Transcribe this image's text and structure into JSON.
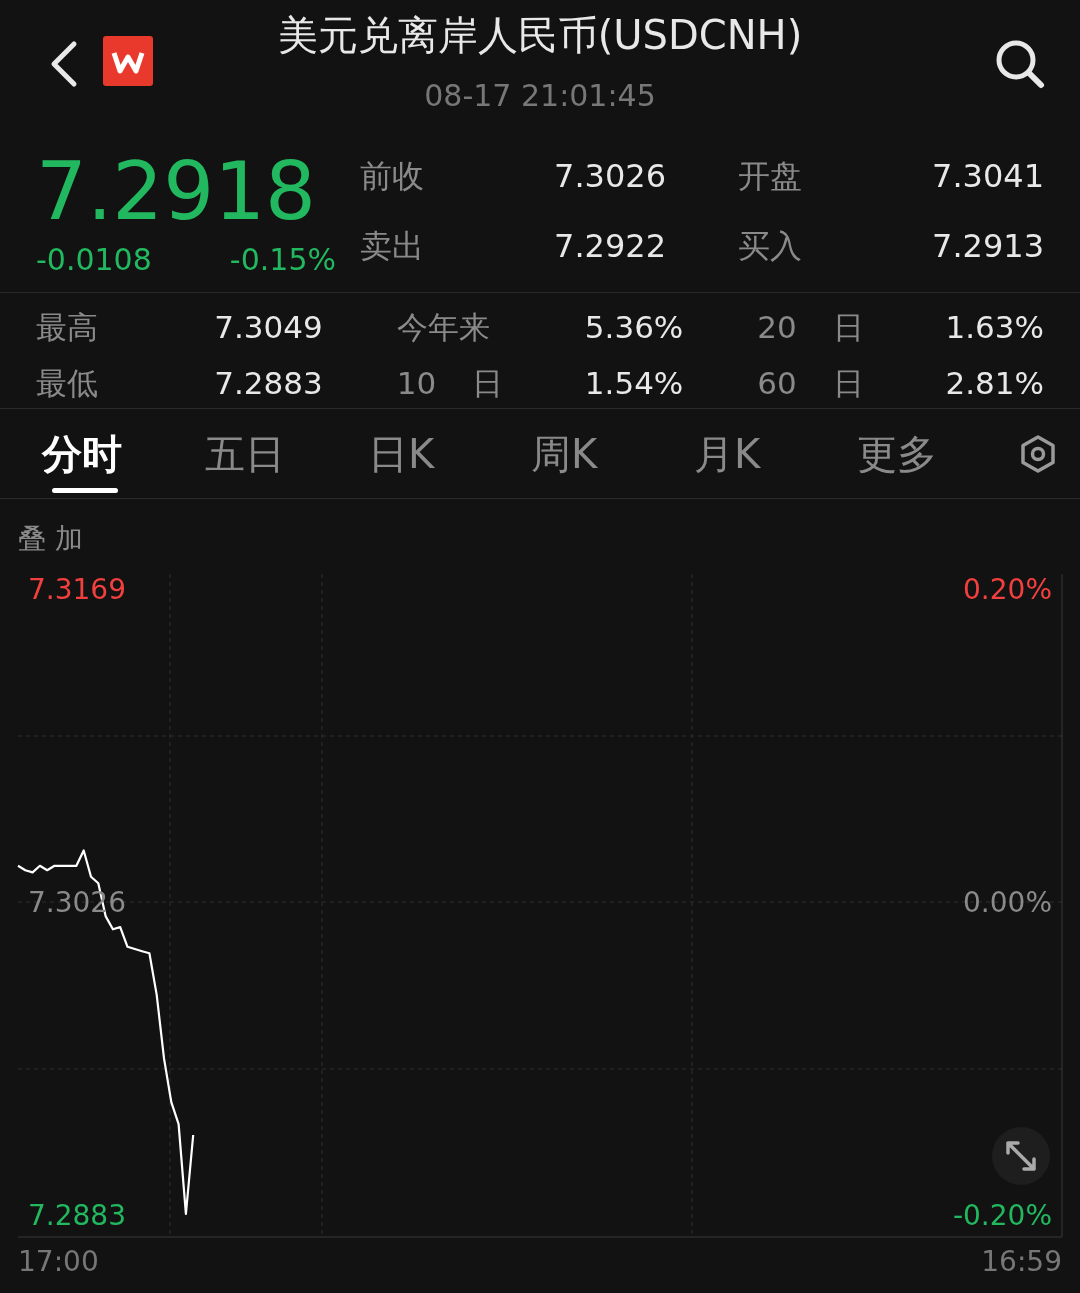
{
  "header": {
    "title": "美元兑离岸人民币(USDCNH)",
    "time": "08-17 21:01:45"
  },
  "quote": {
    "price": "7.2918",
    "change": "-0.0108",
    "change_pct": "-0.15%",
    "color": "#22b85f"
  },
  "quote_stats": [
    {
      "label": "前收",
      "value": "7.3026"
    },
    {
      "label": "开盘",
      "value": "7.3041"
    },
    {
      "label": "卖出",
      "value": "7.2922"
    },
    {
      "label": "买入",
      "value": "7.2913"
    }
  ],
  "stats": [
    {
      "label": "最高",
      "value": "7.3049"
    },
    {
      "label": "今年来",
      "value": "5.36%"
    },
    {
      "label": "20 日",
      "value": "1.63%"
    },
    {
      "label": "最低",
      "value": "7.2883"
    },
    {
      "label": "10 日",
      "value": "1.54%"
    },
    {
      "label": "60 日",
      "value": "2.81%"
    }
  ],
  "tabs": [
    {
      "label": "分时",
      "selected": true
    },
    {
      "label": "五日",
      "selected": false
    },
    {
      "label": "日K",
      "selected": false
    },
    {
      "label": "周K",
      "selected": false
    },
    {
      "label": "月K",
      "selected": false
    },
    {
      "label": "更多",
      "selected": false
    }
  ],
  "chart": {
    "overlay_label": "叠 加",
    "y_left": [
      {
        "color": "#f2403f"
      },
      {
        "color": "#8a8a8a"
      },
      {
        "color": "#22b85f"
      }
    ],
    "y_right": [
      {
        "text": "0.20%",
        "color": "#f2403f"
      },
      {
        "text": "0.00%",
        "color": "#8a8a8a"
      },
      {
        "text": "-0.20%",
        "color": "#22b85f"
      }
    ],
    "x_start": "17:00",
    "x_end": "16:59",
    "chart_data": {
      "type": "line",
      "categories": [
        null,
        null,
        null,
        null,
        null,
        null,
        null,
        null,
        null,
        null,
        null,
        null,
        null,
        null,
        null,
        null,
        null,
        null,
        null,
        null,
        null,
        null,
        null,
        null,
        null,
        null,
        null,
        null,
        null,
        null,
        null,
        null,
        null,
        null,
        null,
        null,
        null,
        null,
        null,
        null,
        null,
        null,
        null,
        null,
        null,
        null,
        null,
        null,
        null,
        null,
        null,
        null,
        null,
        null,
        null,
        null,
        null,
        null,
        null,
        null,
        null,
        null,
        null,
        null,
        null,
        null,
        null,
        null,
        null,
        null,
        null,
        null,
        null,
        null,
        null,
        null,
        null,
        null,
        null,
        null,
        null,
        null,
        null,
        null,
        null,
        null,
        null,
        null,
        null,
        null,
        null,
        null,
        null,
        null,
        null,
        null,
        null,
        null,
        null,
        null,
        null,
        null,
        null,
        null,
        null,
        null,
        null,
        null,
        null,
        null,
        null,
        null,
        null,
        null,
        null,
        null,
        null,
        null,
        null,
        null,
        null,
        null,
        null,
        null,
        null,
        null,
        null,
        null,
        null,
        null,
        null,
        null,
        null,
        null,
        null,
        null,
        null,
        null,
        null,
        null,
        null,
        null,
        null,
        null
      ],
      "ylim": [
        7.2883,
        7.3169
      ],
      "yticks": [
        {
          "value": 7.3169,
          "label": "7.3169"
        },
        {
          "value": 7.3026,
          "label": "7.3026"
        },
        {
          "value": 7.2883,
          "label": "7.2883"
        }
      ],
      "series": [
        {
          "color": "#ffffff",
          "values": [
            7.3043,
            7.3041,
            7.304,
            7.3043,
            7.3041,
            7.3043,
            7.3043,
            7.3043,
            7.3043,
            7.305,
            7.3038,
            7.3035,
            7.302,
            7.3014,
            7.3015,
            7.3006,
            7.3005,
            7.3004,
            7.3003,
            7.2984,
            7.2955,
            7.2935,
            7.2925,
            7.2884,
            7.292,
            null,
            null,
            null,
            null,
            null,
            null,
            null,
            null,
            null,
            null,
            null,
            null,
            null,
            null,
            null,
            null,
            null,
            null,
            null,
            null,
            null,
            null,
            null,
            null,
            null,
            null,
            null,
            null,
            null,
            null,
            null,
            null,
            null,
            null,
            null,
            null,
            null,
            null,
            null,
            null,
            null,
            null,
            null,
            null,
            null,
            null,
            null,
            null,
            null,
            null,
            null,
            null,
            null,
            null,
            null,
            null,
            null,
            null,
            null,
            null,
            null,
            null,
            null,
            null,
            null,
            null,
            null,
            null,
            null,
            null,
            null,
            null,
            null,
            null,
            null,
            null,
            null,
            null,
            null,
            null,
            null,
            null,
            null,
            null,
            null,
            null,
            null,
            null,
            null,
            null,
            null,
            null,
            null,
            null,
            null,
            null,
            null,
            null,
            null,
            null,
            null,
            null,
            null,
            null,
            null,
            null,
            null,
            null,
            null,
            null,
            null,
            null,
            null,
            null,
            null,
            null,
            null,
            null,
            null
          ]
        }
      ]
    }
  }
}
